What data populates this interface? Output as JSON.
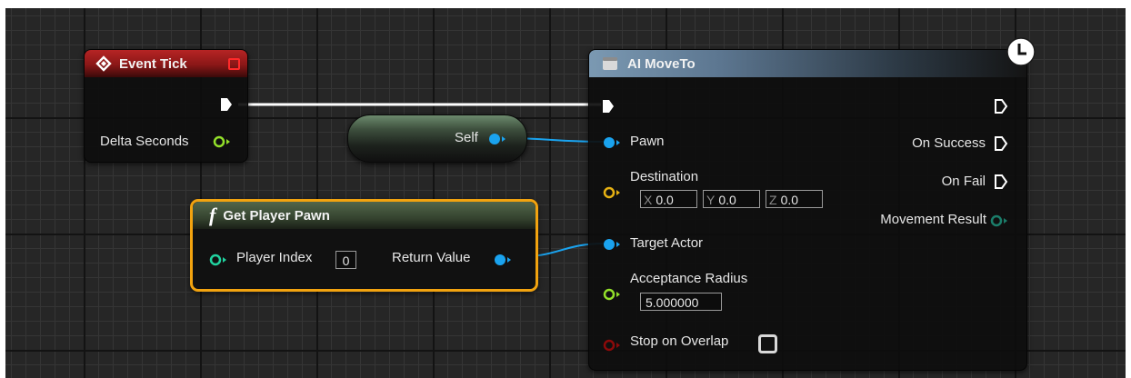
{
  "event_tick": {
    "title": "Event Tick",
    "delta_seconds_label": "Delta Seconds"
  },
  "self_node": {
    "label": "Self"
  },
  "get_player_pawn": {
    "function_glyph": "f",
    "title": "Get Player Pawn",
    "player_index_label": "Player Index",
    "player_index_value": "0",
    "return_value_label": "Return Value"
  },
  "ai_moveto": {
    "title": "AI MoveTo",
    "pawn_label": "Pawn",
    "destination_label": "Destination",
    "destination": {
      "x_label": "X",
      "x": "0.0",
      "y_label": "Y",
      "y": "0.0",
      "z_label": "Z",
      "z": "0.0"
    },
    "target_actor_label": "Target Actor",
    "acceptance_radius_label": "Acceptance Radius",
    "acceptance_radius_value": "5.000000",
    "stop_on_overlap_label": "Stop on Overlap",
    "stop_on_overlap_checked": false,
    "on_success_label": "On Success",
    "on_fail_label": "On Fail",
    "movement_result_label": "Movement Result",
    "latent_icon": "clock-icon"
  },
  "colors": {
    "exec_wire": "#ffffff",
    "object_pin": "#1aa3ef",
    "vector_pin": "#e7b213",
    "float_pin": "#93e02a",
    "int_pin": "#21d3a0",
    "bool_pin": "#8c0a0a",
    "event_header": "#9b1c1c",
    "function_header": "#3b4b35",
    "latent_header": "#5e7891",
    "selection": "#f2a30f"
  }
}
